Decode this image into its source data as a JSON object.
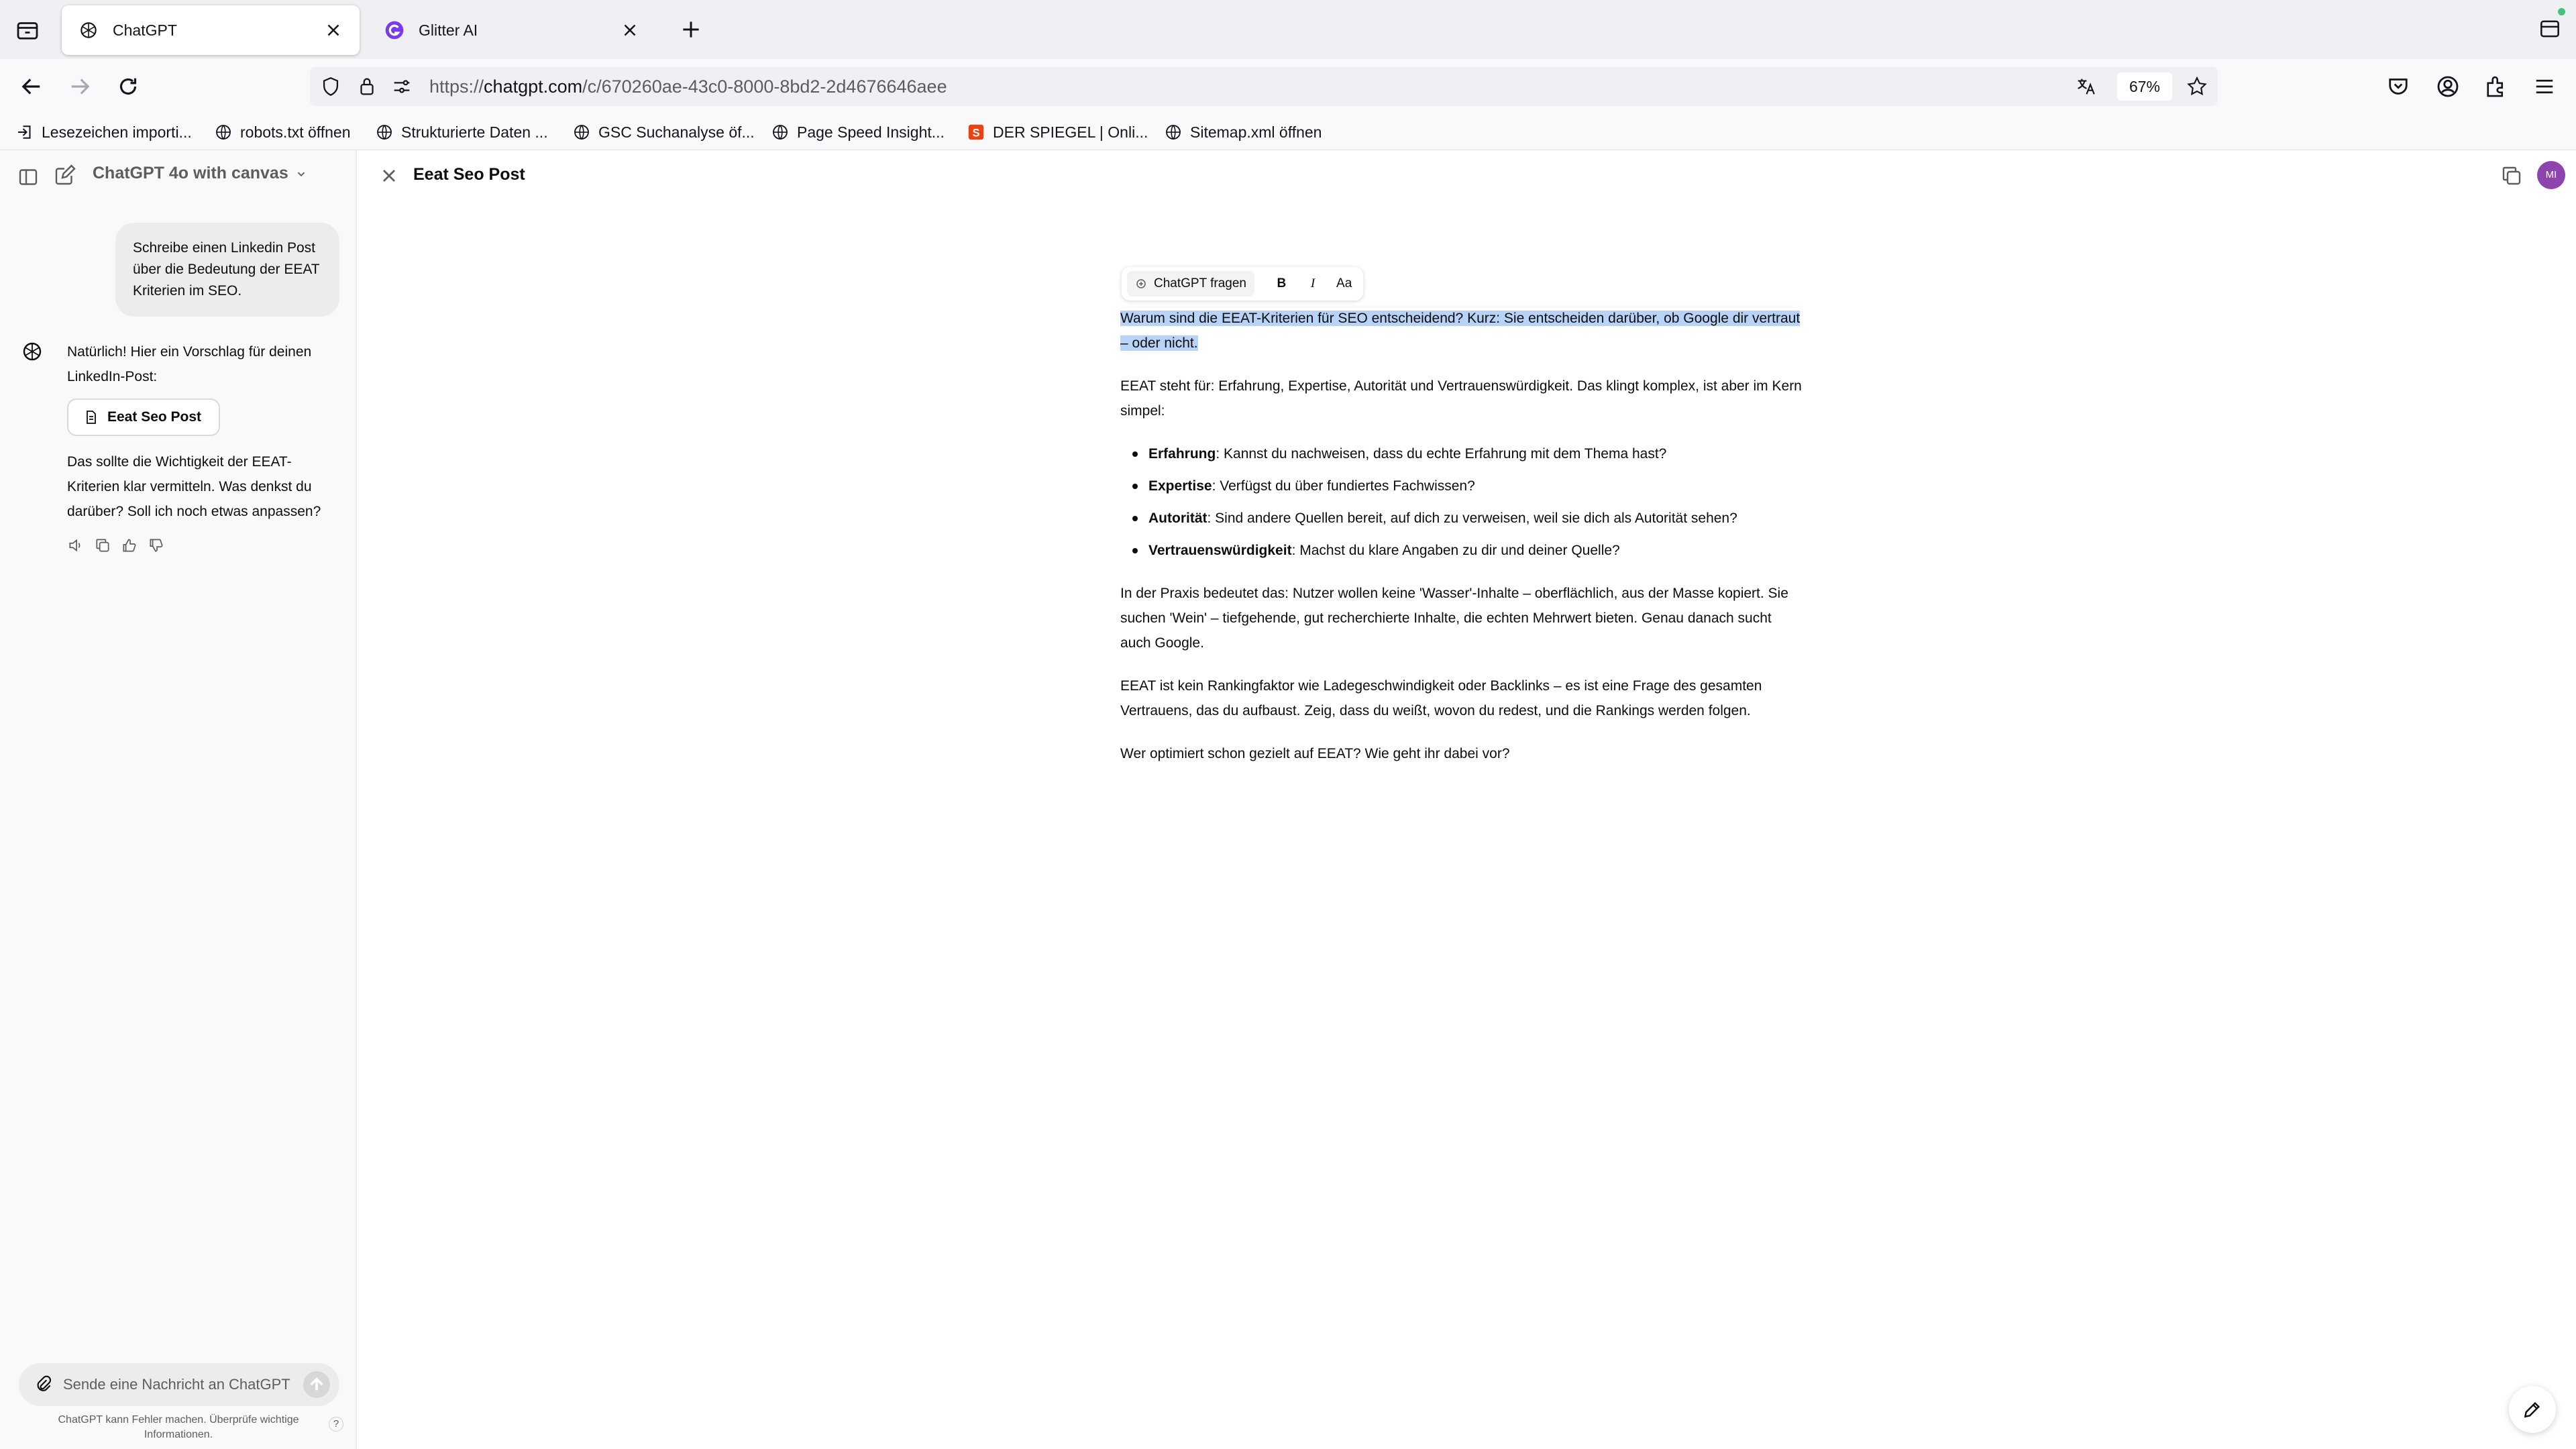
{
  "browser": {
    "tabs": [
      {
        "title": "ChatGPT",
        "active": true
      },
      {
        "title": "Glitter AI",
        "active": false
      }
    ],
    "url": {
      "prefix": "https://",
      "domain": "chatgpt.com",
      "path": "/c/670260ae-43c0-8000-8bd2-2d4676646aee"
    },
    "zoom": "67%",
    "bookmarks": [
      {
        "label": "Lesezeichen importi...",
        "icon": "import-icon"
      },
      {
        "label": "robots.txt öffnen",
        "icon": "globe-icon"
      },
      {
        "label": "Strukturierte Daten ...",
        "icon": "globe-icon"
      },
      {
        "label": "GSC Suchanalyse öf...",
        "icon": "globe-icon"
      },
      {
        "label": "Page Speed Insight...",
        "icon": "globe-icon"
      },
      {
        "label": "DER SPIEGEL | Onli...",
        "icon": "spiegel-icon"
      },
      {
        "label": "Sitemap.xml öffnen",
        "icon": "globe-icon"
      }
    ]
  },
  "chat": {
    "model_title": "ChatGPT 4o with canvas",
    "user_message": "Schreibe einen Linkedin Post über die Bedeutung der EEAT Kriterien im SEO.",
    "assistant_intro": "Natürlich! Hier ein Vorschlag für deinen LinkedIn-Post:",
    "canvas_chip": "Eeat Seo Post",
    "assistant_outro": "Das sollte die Wichtigkeit der EEAT-Kriterien klar vermitteln. Was denkst du darüber? Soll ich noch etwas anpassen?",
    "composer_placeholder": "Sende eine Nachricht an ChatGPT",
    "disclaimer": "ChatGPT kann Fehler machen. Überprüfe wichtige Informationen.",
    "help": "?"
  },
  "canvas": {
    "title": "Eeat Seo Post",
    "user_initials": "MI",
    "toolbar": {
      "ask": "ChatGPT fragen",
      "bold": "B",
      "italic": "I",
      "size": "Aa"
    },
    "selected_paragraph": "Warum sind die EEAT-Kriterien für SEO entscheidend? Kurz: Sie entscheiden darüber, ob Google dir vertraut – oder nicht.",
    "intro": "EEAT steht für: Erfahrung, Expertise, Autorität und Vertrauenswürdigkeit. Das klingt komplex, ist aber im Kern simpel:",
    "bullets": [
      {
        "term": "Erfahrung",
        "text": ": Kannst du nachweisen, dass du echte Erfahrung mit dem Thema hast?"
      },
      {
        "term": "Expertise",
        "text": ": Verfügst du über fundiertes Fachwissen?"
      },
      {
        "term": "Autorität",
        "text": ": Sind andere Quellen bereit, auf dich zu verweisen, weil sie dich als Autorität sehen?"
      },
      {
        "term": "Vertrauenswürdigkeit",
        "text": ": Machst du klare Angaben zu dir und deiner Quelle?"
      }
    ],
    "paragraph_practice": "In der Praxis bedeutet das: Nutzer wollen keine 'Wasser'-Inhalte – oberflächlich, aus der Masse kopiert. Sie suchen 'Wein' – tiefgehende, gut recherchierte Inhalte, die echten Mehrwert bieten. Genau danach sucht auch Google.",
    "paragraph_trust": "EEAT ist kein Rankingfaktor wie Ladegeschwindigkeit oder Backlinks – es ist eine Frage des gesamten Vertrauens, das du aufbaust. Zeig, dass du weißt, wovon du redest, und die Rankings werden folgen.",
    "question": "Wer optimiert schon gezielt auf EEAT? Wie geht ihr dabei vor?"
  },
  "colors": {
    "selection": "#b8d3f5",
    "avatar": "#8e44ad",
    "sidebar_bg": "#f9f9f9"
  }
}
